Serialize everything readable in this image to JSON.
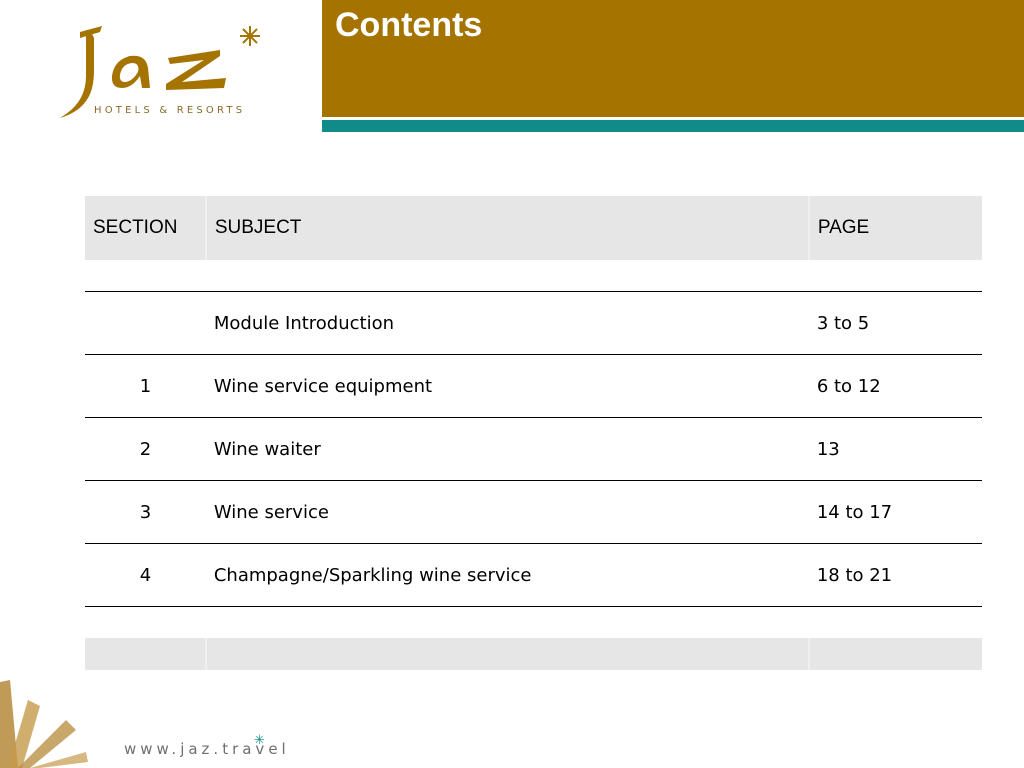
{
  "brand": {
    "logo_word": "jaz",
    "logo_tagline": "HOTELS & RESORTS",
    "website": "www.jaz.travel",
    "colors": {
      "gold": "#a57400",
      "teal": "#0f8c8a",
      "header_gray": "#e6e6e6"
    }
  },
  "header": {
    "title": "Contents"
  },
  "table": {
    "columns": [
      "SECTION",
      "SUBJECT",
      "PAGE"
    ],
    "rows": [
      {
        "section": "",
        "subject": "Module Introduction",
        "page": "3 to 5"
      },
      {
        "section": "1",
        "subject": "Wine service equipment",
        "page": "6 to 12"
      },
      {
        "section": "2",
        "subject": "Wine waiter",
        "page": "13"
      },
      {
        "section": "3",
        "subject": "Wine service",
        "page": "14 to 17"
      },
      {
        "section": "4",
        "subject": "Champagne/Sparkling wine service",
        "page": "18 to 21"
      }
    ]
  }
}
